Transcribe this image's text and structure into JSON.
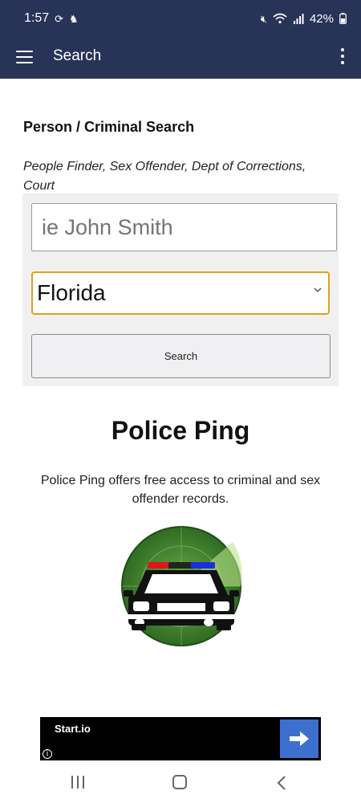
{
  "status_bar": {
    "time": "1:57",
    "battery": "42%"
  },
  "app_bar": {
    "title": "Search"
  },
  "search_section": {
    "title": "Person / Criminal Search",
    "subtitle": "People Finder, Sex Offender, Dept of Corrections, Court",
    "name_input": {
      "placeholder": "ie John Smith",
      "value": ""
    },
    "state_select": {
      "value": "Florida"
    },
    "search_button_label": "Search"
  },
  "brand": {
    "heading": "Police Ping",
    "description": "Police Ping offers free access to criminal and sex offender records."
  },
  "ad": {
    "brand": "Start.io"
  },
  "colors": {
    "header_bg": "#283358",
    "select_border": "#dba222",
    "ad_button": "#3d6fcf",
    "radar_green": "#3f7d2c"
  }
}
